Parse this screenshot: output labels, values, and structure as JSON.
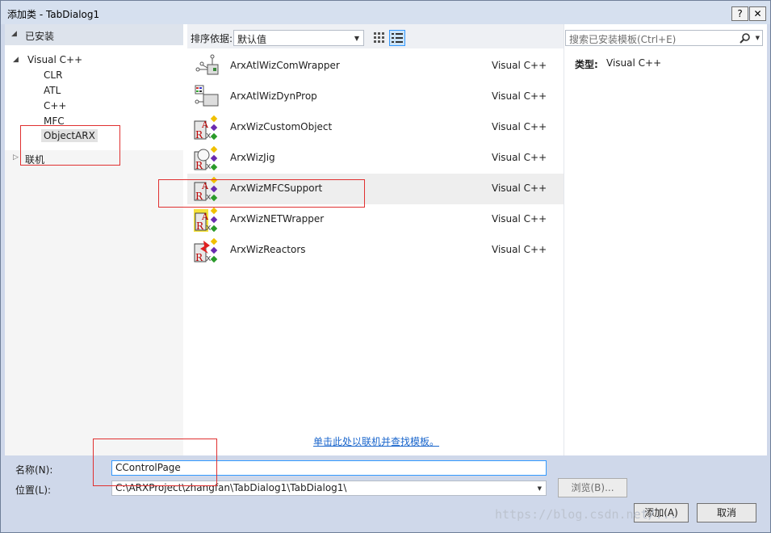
{
  "window": {
    "title": "添加类 - TabDialog1",
    "help_label": "?",
    "close_label": "✕"
  },
  "tree": {
    "installed_label": "已安装",
    "root_label": "Visual C++",
    "children": [
      "CLR",
      "ATL",
      "C++",
      "MFC",
      "ObjectARX"
    ],
    "selected": "ObjectARX",
    "online_label": "联机"
  },
  "sortbar": {
    "label": "排序依据:",
    "value": "默认值"
  },
  "templates": [
    {
      "name": "ArxAtlWizComWrapper",
      "lang": "Visual C++",
      "icon": "com-wrapper-icon"
    },
    {
      "name": "ArxAtlWizDynProp",
      "lang": "Visual C++",
      "icon": "dynprop-icon"
    },
    {
      "name": "ArxWizCustomObject",
      "lang": "Visual C++",
      "icon": "arx-ribbon-icon"
    },
    {
      "name": "ArxWizJig",
      "lang": "Visual C++",
      "icon": "arx-jig-icon"
    },
    {
      "name": "ArxWizMFCSupport",
      "lang": "Visual C++",
      "icon": "arx-ribbon-icon"
    },
    {
      "name": "ArxWizNETWrapper",
      "lang": "Visual C++",
      "icon": "arx-net-icon"
    },
    {
      "name": "ArxWizReactors",
      "lang": "Visual C++",
      "icon": "arx-reactor-icon"
    }
  ],
  "selected_template": "ArxWizMFCSupport",
  "online_link": "单击此处以联机并查找模板。",
  "search": {
    "placeholder": "搜索已安装模板(Ctrl+E)"
  },
  "details": {
    "type_label": "类型:",
    "type_value": "Visual C++"
  },
  "name_field": {
    "label": "名称(N):",
    "value": "CControlPage"
  },
  "location_field": {
    "label": "位置(L):",
    "value": "C:\\ARXProject\\zhangfan\\TabDialog1\\TabDialog1\\"
  },
  "buttons": {
    "browse": "浏览(B)...",
    "add": "添加(A)",
    "cancel": "取消"
  },
  "watermark": "https://blog.csdn.net/...",
  "colors": {
    "accent": "#3399ff",
    "annotation": "#e03030",
    "link": "#1a66cc"
  }
}
